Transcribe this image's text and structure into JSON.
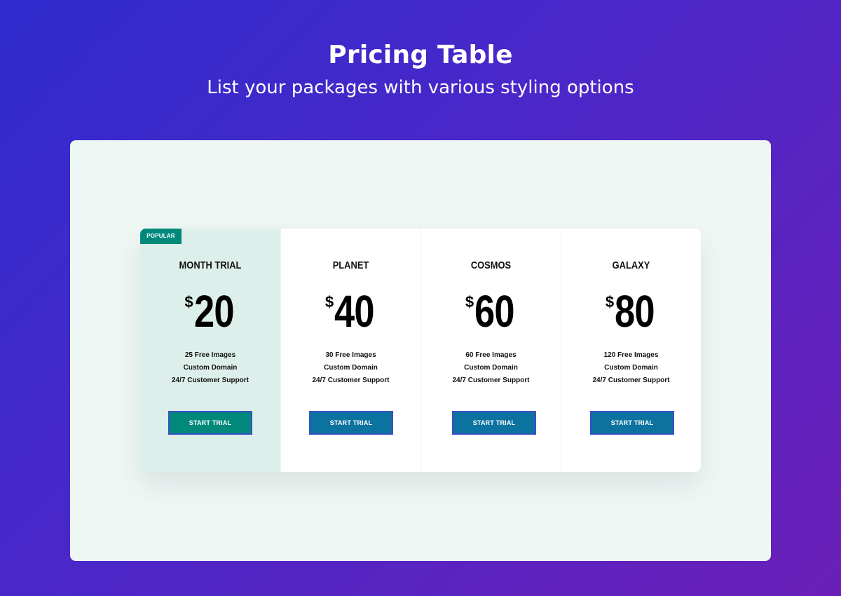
{
  "header": {
    "title": "Pricing Table",
    "subtitle": "List your packages with various styling options"
  },
  "colors": {
    "background_gradient_start": "#2f2ccd",
    "background_gradient_end": "#6b1fb8",
    "canvas": "#eff7f5",
    "popular_column": "#ddefeb",
    "popular_accent": "#00897b",
    "button": "#0c73a0",
    "button_border": "#3b4fc8"
  },
  "plans": [
    {
      "badge": "POPULAR",
      "name": "MONTH TRIAL",
      "currency": "$",
      "price": "20",
      "features": [
        "25 Free Images",
        "Custom Domain",
        "24/7 Customer Support"
      ],
      "button_label": "START TRIAL"
    },
    {
      "name": "PLANET",
      "currency": "$",
      "price": "40",
      "features": [
        "30 Free Images",
        "Custom Domain",
        "24/7 Customer Support"
      ],
      "button_label": "START TRIAL"
    },
    {
      "name": "COSMOS",
      "currency": "$",
      "price": "60",
      "features": [
        "60 Free Images",
        "Custom Domain",
        "24/7 Customer Support"
      ],
      "button_label": "START TRIAL"
    },
    {
      "name": "GALAXY",
      "currency": "$",
      "price": "80",
      "features": [
        "120 Free Images",
        "Custom Domain",
        "24/7 Customer Support"
      ],
      "button_label": "START TRIAL"
    }
  ]
}
